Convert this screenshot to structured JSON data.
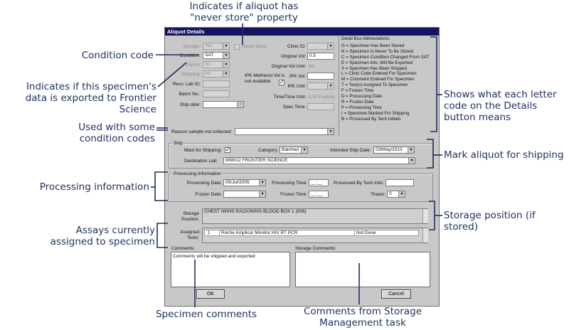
{
  "annotations": {
    "never_store": "Indicates if aliquot has \"never store\" property",
    "condition_code": "Condition code",
    "exported": "Indicates if this specimen's data is exported to Frontier Science",
    "used_with_codes": "Used with some condition codes",
    "letter_code": "Shows what each letter code on the Details button means",
    "mark_shipping": "Mark aliquot for shipping",
    "processing_info": "Processing information",
    "storage_position": "Storage position (if stored)",
    "assays": "Assays currently assigned to specimen",
    "specimen_comments": "Specimen comments",
    "storage_comments": "Comments from Storage Management task"
  },
  "dialog": {
    "title": "Aliquot Details",
    "storage_label": "Storage:",
    "storage_value": "Yes",
    "never_store_label": "Never Store",
    "condition_label": "Condition:",
    "condition_value": "SAT",
    "export_label": "Export:",
    "export_value": "No",
    "shipping_label": "Shipping:",
    "shipping_value": "No",
    "recv_lab_id_label": "Recv. Lab ID:",
    "batch_no_label": "Batch No.:",
    "ship_date_label": "Ship date:",
    "clinic_id_label": "Clinic ID:",
    "original_vol_label": "Original Vol:",
    "original_vol_value": "0.5",
    "original_vol_unit_label": "Original Vol Unit:",
    "original_vol_unit_value": "ML",
    "ipk_note": "IPK Methanol Vol is not available",
    "ipk_vol_label": "IPK Vol:",
    "ipk_unit_label": "IPK Unit:",
    "time_unit_label": "Time/Time Unit:",
    "time_unit_value": "-1.00 Fasting",
    "spec_time_label": "Spec Time:",
    "abbreviations_title": "Detail Box Abbreviations:",
    "abbreviations": [
      "G = Specimen Has Been Stored",
      "N = Specimen Is Never To Be Stored",
      "C = Specimen Condition Changed From SAT",
      "E = Specimen Info. Will Be Exported",
      "S = Specimen Has Been Shipped",
      "L = Clinic Code Entered For Specimen",
      "M = Comment Entered For Specimen",
      "T = Test(s) Assigned To Specimen",
      "F = Frozen Time",
      "D = Processing Date",
      "R = Frozen Date",
      "P = Processing Time",
      "I = Specimen Marked For Shipping",
      "B = Processed By Tech Initials"
    ],
    "reason_label": "Reason sample not collected:",
    "ship_group": "Ship",
    "mark_shipping_label": "Mark for Shipping:",
    "category_label": "Category:",
    "category_value": "Batched",
    "intended_ship_date_label": "Intended Ship Date:",
    "intended_ship_date_value": "03/May/2013",
    "destination_lab_label": "Destination Lab:",
    "destination_lab_value": "999012  FRONTIER SCIENCE",
    "processing_group": "Processing Information",
    "processing_date_label": "Processing Date:",
    "processing_date_value": "05/Jul/2005",
    "processing_time_label": "Processing Time:",
    "processing_time_value": "__:__",
    "processed_by_label": "Processed By Tech Inits:",
    "frozen_date_label": "Frozen Date:",
    "frozen_time_label": "Frozen Time:",
    "frozen_time_value": "__:__",
    "thaws_label": "Thaws:",
    "thaws_value": "0",
    "storage_position_label": "Storage Position:",
    "storage_position_value": "CHEST /WIHS RACK/WIHS BLOOD BOX 1   (006)",
    "assigned_tests_label": "Assigned Tests:",
    "test_row": {
      "num": "1",
      "name": "Roche Amplicor Monitor HIV RT PCR",
      "status": "Not Done"
    },
    "comments_label": "Comments:",
    "comments_value": "Comments will be shipped and exported",
    "storage_comments_label": "Storage Comments:",
    "ok_label": "OK",
    "cancel_label": "Cancel"
  }
}
